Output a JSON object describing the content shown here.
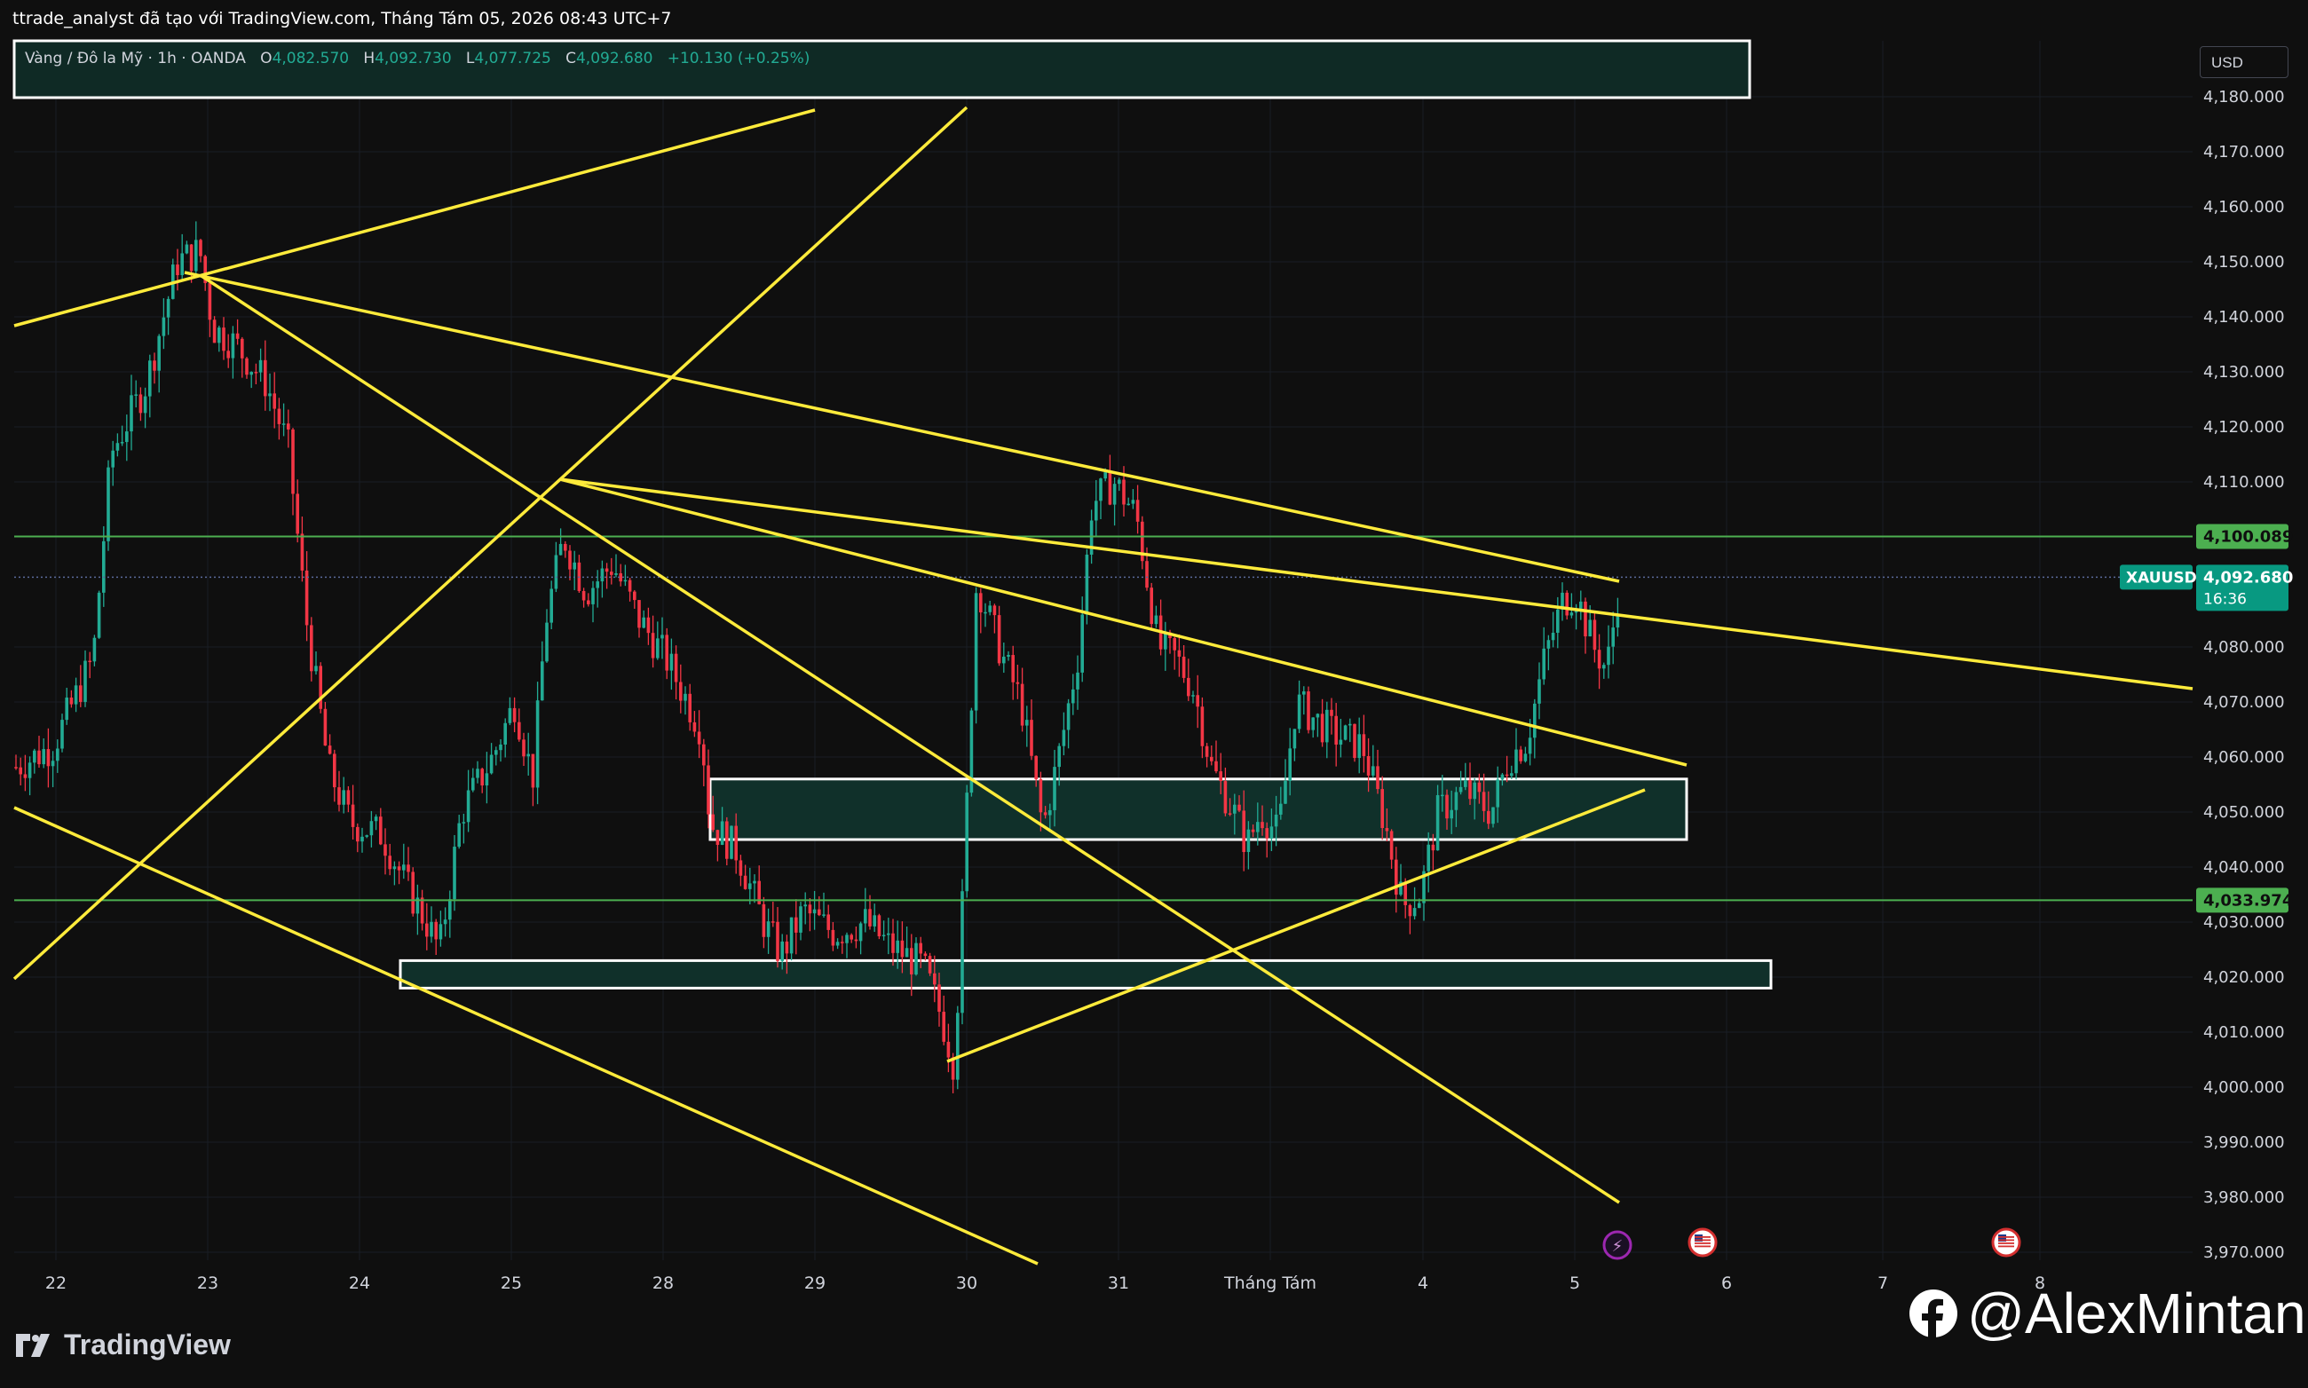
{
  "header": {
    "attribution": "ttrade_analyst đã tạo với TradingView.com, Tháng Tám 05, 2026 08:43 UTC+7"
  },
  "symbol": {
    "name": "Vàng / Đô la Mỹ · 1h · OANDA",
    "open_label": "O",
    "open": "4,082.570",
    "high_label": "H",
    "high": "4,092.730",
    "low_label": "L",
    "low": "4,077.725",
    "close_label": "C",
    "close": "4,092.680",
    "change": "+10.130 (+0.25%)"
  },
  "currency": "USD",
  "price_axis": {
    "labels": [
      "4,180.000",
      "4,170.000",
      "4,160.000",
      "4,150.000",
      "4,140.000",
      "4,130.000",
      "4,120.000",
      "4,110.000",
      "4,080.000",
      "4,070.000",
      "4,060.000",
      "4,050.000",
      "4,040.000",
      "4,030.000",
      "4,020.000",
      "4,010.000",
      "4,000.000",
      "3,990.000",
      "3,980.000",
      "3,970.000"
    ],
    "values": [
      4180,
      4170,
      4160,
      4150,
      4140,
      4130,
      4120,
      4110,
      4080,
      4070,
      4060,
      4050,
      4040,
      4030,
      4020,
      4010,
      4000,
      3990,
      3980,
      3970
    ],
    "marker_high": "4,100.089",
    "marker_low": "4,033.974",
    "symbol_tag": "XAUUSD",
    "current_price": "4,092.680",
    "countdown": "16:36"
  },
  "time_axis": {
    "labels": [
      "22",
      "23",
      "24",
      "25",
      "28",
      "29",
      "30",
      "31",
      "Tháng Tám",
      "4",
      "5",
      "6",
      "7",
      "8"
    ]
  },
  "colors": {
    "up": "#22ab94",
    "down": "#f23645",
    "trendline": "#ffeb3b",
    "level": "#4caf50",
    "zone_fill": "#10302a",
    "zone_border": "#ffffff"
  },
  "footer": {
    "logo_text": "TradingView",
    "watermark": "@AlexMintan"
  },
  "chart_data": {
    "type": "candlestick",
    "symbol": "XAUUSD",
    "timeframe": "1h",
    "ylim": [
      3967,
      4188
    ],
    "horizontal_levels": [
      4100.089,
      4033.974
    ],
    "zones": [
      {
        "from": 4045,
        "to": 4056
      },
      {
        "from": 4018,
        "to": 4023
      }
    ],
    "last_close": 4092.68
  }
}
